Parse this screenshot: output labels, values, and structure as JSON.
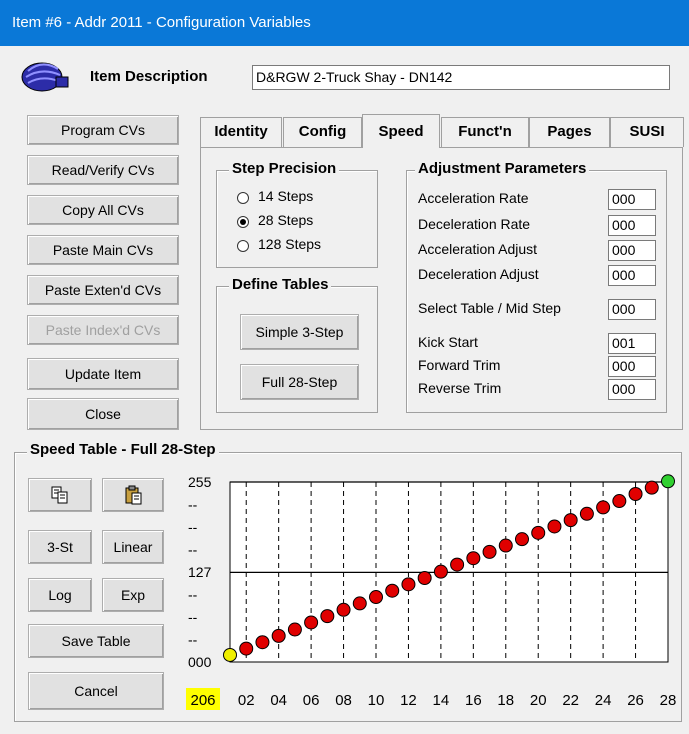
{
  "window": {
    "title": "Item #6 - Addr 2011 - Configuration Variables"
  },
  "item": {
    "description_label": "Item Description",
    "description_value": "D&RGW 2-Truck Shay - DN142",
    "icon": "decoder-chip-icon"
  },
  "left_buttons": [
    {
      "label": "Program CVs",
      "enabled": true
    },
    {
      "label": "Read/Verify CVs",
      "enabled": true
    },
    {
      "label": "Copy All CVs",
      "enabled": true
    },
    {
      "label": "Paste Main CVs",
      "enabled": true
    },
    {
      "label": "Paste Exten'd CVs",
      "enabled": true
    },
    {
      "label": "Paste Index'd CVs",
      "enabled": false
    },
    {
      "label": "Update Item",
      "enabled": true
    },
    {
      "label": "Close",
      "enabled": true
    }
  ],
  "tabs": [
    {
      "label": "Identity",
      "active": false
    },
    {
      "label": "Config",
      "active": false
    },
    {
      "label": "Speed",
      "active": true
    },
    {
      "label": "Funct'n",
      "active": false
    },
    {
      "label": "Pages",
      "active": false
    },
    {
      "label": "SUSI",
      "active": false
    }
  ],
  "step_precision": {
    "title": "Step Precision",
    "options": [
      {
        "label": "14 Steps",
        "selected": false
      },
      {
        "label": "28 Steps",
        "selected": true
      },
      {
        "label": "128 Steps",
        "selected": false
      }
    ]
  },
  "define_tables": {
    "title": "Define Tables",
    "simple_label": "Simple 3-Step",
    "full_label": "Full 28-Step"
  },
  "adjustment": {
    "title": "Adjustment Parameters",
    "params": [
      {
        "label": "Acceleration Rate",
        "value": "000"
      },
      {
        "label": "Deceleration Rate",
        "value": "000"
      },
      {
        "label": "Acceleration Adjust",
        "value": "000"
      },
      {
        "label": "Deceleration Adjust",
        "value": "000"
      },
      {
        "label": "Select Table / Mid Step",
        "value": "000"
      },
      {
        "label": "Kick Start",
        "value": "001"
      },
      {
        "label": "Forward Trim",
        "value": "000"
      },
      {
        "label": "Reverse Trim",
        "value": "000"
      }
    ]
  },
  "speed_table": {
    "title": "Speed Table - Full 28-Step",
    "copy_icon": "copy-icon",
    "paste_icon": "paste-icon",
    "btn_3st": "3-St",
    "btn_linear": "Linear",
    "btn_log": "Log",
    "btn_exp": "Exp",
    "btn_save": "Save Table",
    "btn_cancel": "Cancel",
    "selected_value": "206",
    "y_tick_labels": [
      "255",
      "--",
      "--",
      "--",
      "127",
      "--",
      "--",
      "--",
      "000"
    ],
    "x_tick_labels": [
      "02",
      "04",
      "06",
      "08",
      "10",
      "12",
      "14",
      "16",
      "18",
      "20",
      "22",
      "24",
      "26",
      "28"
    ]
  },
  "chart_data": {
    "type": "scatter",
    "x": [
      1,
      2,
      3,
      4,
      5,
      6,
      7,
      8,
      9,
      10,
      11,
      12,
      13,
      14,
      15,
      16,
      17,
      18,
      19,
      20,
      21,
      22,
      23,
      24,
      25,
      26,
      27,
      28
    ],
    "values": [
      10,
      19,
      28,
      37,
      46,
      56,
      65,
      74,
      83,
      92,
      101,
      110,
      119,
      128,
      138,
      147,
      156,
      165,
      174,
      183,
      192,
      201,
      210,
      219,
      228,
      238,
      247,
      256
    ],
    "point_colors": {
      "first": "#f0f000",
      "middle": "#e00000",
      "last": "#30d030"
    },
    "ylim": [
      0,
      255
    ],
    "xlim": [
      1,
      28
    ],
    "grid": true
  }
}
